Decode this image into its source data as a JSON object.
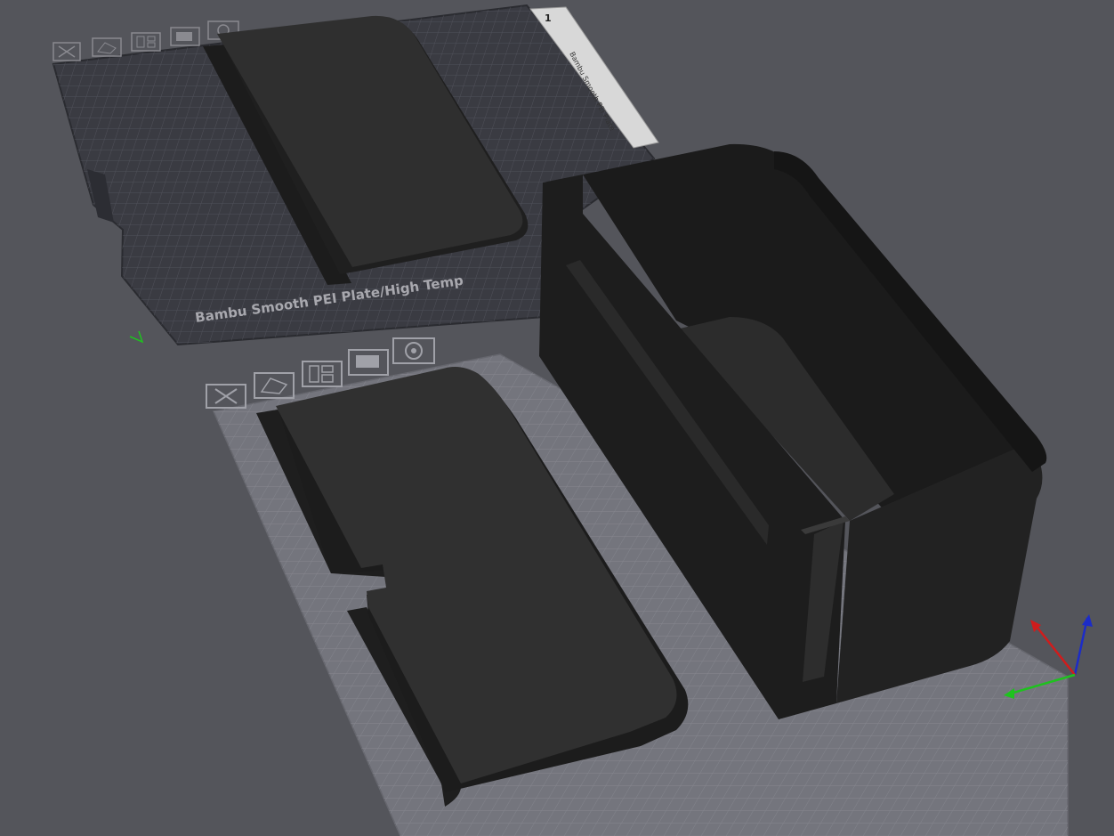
{
  "app": {
    "view": "3D prepare view"
  },
  "plate_top": {
    "label": "Bambu Smooth PEI Plate/High Temp",
    "side_label": "Bambu Smooth PEI Plate",
    "corner_number": "1",
    "toolbar_icons": [
      "close-icon",
      "auto-orient-icon",
      "arrange-icon",
      "lock-icon",
      "settings-gear-icon"
    ]
  },
  "plate_active": {
    "toolbar_icons": [
      "close-icon",
      "auto-orient-icon",
      "arrange-icon",
      "lock-icon",
      "settings-gear-icon"
    ]
  },
  "axes": {
    "x_color": "#d01c1c",
    "y_color": "#1ec21e",
    "z_color": "#1c2cc8"
  },
  "colors": {
    "background": "#54555b",
    "inactive_plate": "#3a3b42",
    "active_plate": "#74757d",
    "model_top": "#2f2f2f",
    "model_side": "#1c1c1c"
  }
}
